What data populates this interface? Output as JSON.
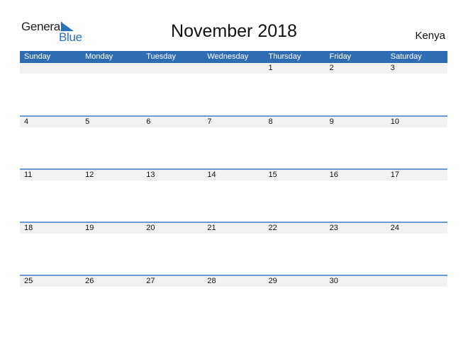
{
  "logo": {
    "word1": "General",
    "word2": "Blue",
    "icon": "triangle-flag-icon",
    "brand_color": "#2a72b5"
  },
  "title": "November 2018",
  "country": "Kenya",
  "colors": {
    "header_bg": "#2f6db3",
    "row_band": "#f2f2f2",
    "row_line": "#6b9bd0"
  },
  "weekdays": [
    "Sunday",
    "Monday",
    "Tuesday",
    "Wednesday",
    "Thursday",
    "Friday",
    "Saturday"
  ],
  "weeks": [
    [
      "",
      "",
      "",
      "",
      "1",
      "2",
      "3"
    ],
    [
      "4",
      "5",
      "6",
      "7",
      "8",
      "9",
      "10"
    ],
    [
      "11",
      "12",
      "13",
      "14",
      "15",
      "16",
      "17"
    ],
    [
      "18",
      "19",
      "20",
      "21",
      "22",
      "23",
      "24"
    ],
    [
      "25",
      "26",
      "27",
      "28",
      "29",
      "30",
      ""
    ]
  ]
}
